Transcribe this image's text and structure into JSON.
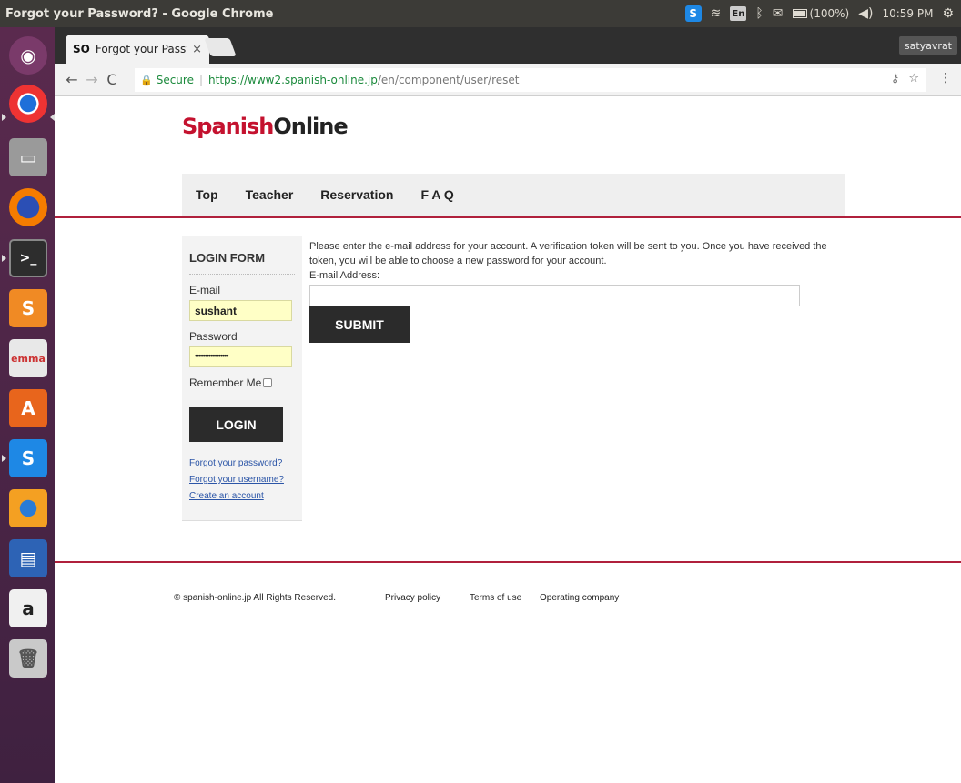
{
  "system_bar": {
    "window_title": "Forgot your Password? - Google Chrome",
    "skype_badge": "S",
    "keyboard_layout": "En",
    "battery": "(100%)",
    "time": "10:59 PM"
  },
  "launcher": {
    "apps": [
      "ubuntu-dash",
      "chrome",
      "files",
      "firefox",
      "terminal",
      "sublime-text",
      "mysql-workbench",
      "software-center",
      "skype-preview",
      "app-center",
      "libreoffice-writer",
      "amazon",
      "trash"
    ],
    "colors": {
      "background": "#4e2748"
    }
  },
  "browser": {
    "tab_favicon": "SO",
    "tab_title": "Forgot your Passw",
    "tab_close": "×",
    "user_chip": "satyavrat",
    "secure_label": "Secure",
    "url_host": "https://www2.spanish-online.jp",
    "url_path": "/en/component/user/reset"
  },
  "site": {
    "logo_red": "Spanish",
    "logo_dark": "Online",
    "nav": [
      "Top",
      "Teacher",
      "Reservation",
      "F A Q"
    ],
    "colors": {
      "accent": "#c4122f",
      "rule": "#b0203c",
      "button": "#2b2b2b"
    }
  },
  "login_form": {
    "title": "LOGIN FORM",
    "email_label": "E-mail",
    "email_value": "sushant",
    "password_label": "Password",
    "password_value": "•••••••••••••••••",
    "remember_label": "Remember Me",
    "login_button": "LOGIN",
    "links": [
      "Forgot your password?",
      "Forgot your username?",
      "Create an account"
    ]
  },
  "reset_form": {
    "instructions": "Please enter the e-mail address for your account. A verification token will be sent to you. Once you have received the token, you will be able to choose a new password for your account.",
    "email_label": "E-mail Address:",
    "email_value": "",
    "submit_button": "SUBMIT"
  },
  "footer": {
    "copyright": "© spanish-online.jp  All Rights Reserved.",
    "links": [
      "Privacy policy",
      "Terms of use",
      "Operating company"
    ]
  }
}
